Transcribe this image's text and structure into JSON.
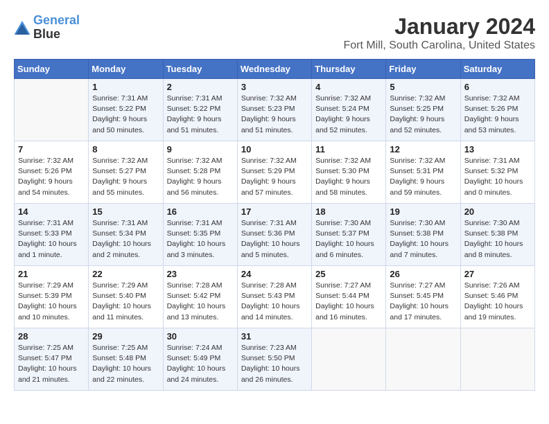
{
  "logo": {
    "line1": "General",
    "line2": "Blue"
  },
  "title": "January 2024",
  "subtitle": "Fort Mill, South Carolina, United States",
  "days_of_week": [
    "Sunday",
    "Monday",
    "Tuesday",
    "Wednesday",
    "Thursday",
    "Friday",
    "Saturday"
  ],
  "weeks": [
    [
      {
        "day": "",
        "info": ""
      },
      {
        "day": "1",
        "info": "Sunrise: 7:31 AM\nSunset: 5:22 PM\nDaylight: 9 hours\nand 50 minutes."
      },
      {
        "day": "2",
        "info": "Sunrise: 7:31 AM\nSunset: 5:22 PM\nDaylight: 9 hours\nand 51 minutes."
      },
      {
        "day": "3",
        "info": "Sunrise: 7:32 AM\nSunset: 5:23 PM\nDaylight: 9 hours\nand 51 minutes."
      },
      {
        "day": "4",
        "info": "Sunrise: 7:32 AM\nSunset: 5:24 PM\nDaylight: 9 hours\nand 52 minutes."
      },
      {
        "day": "5",
        "info": "Sunrise: 7:32 AM\nSunset: 5:25 PM\nDaylight: 9 hours\nand 52 minutes."
      },
      {
        "day": "6",
        "info": "Sunrise: 7:32 AM\nSunset: 5:26 PM\nDaylight: 9 hours\nand 53 minutes."
      }
    ],
    [
      {
        "day": "7",
        "info": "Sunrise: 7:32 AM\nSunset: 5:26 PM\nDaylight: 9 hours\nand 54 minutes."
      },
      {
        "day": "8",
        "info": "Sunrise: 7:32 AM\nSunset: 5:27 PM\nDaylight: 9 hours\nand 55 minutes."
      },
      {
        "day": "9",
        "info": "Sunrise: 7:32 AM\nSunset: 5:28 PM\nDaylight: 9 hours\nand 56 minutes."
      },
      {
        "day": "10",
        "info": "Sunrise: 7:32 AM\nSunset: 5:29 PM\nDaylight: 9 hours\nand 57 minutes."
      },
      {
        "day": "11",
        "info": "Sunrise: 7:32 AM\nSunset: 5:30 PM\nDaylight: 9 hours\nand 58 minutes."
      },
      {
        "day": "12",
        "info": "Sunrise: 7:32 AM\nSunset: 5:31 PM\nDaylight: 9 hours\nand 59 minutes."
      },
      {
        "day": "13",
        "info": "Sunrise: 7:31 AM\nSunset: 5:32 PM\nDaylight: 10 hours\nand 0 minutes."
      }
    ],
    [
      {
        "day": "14",
        "info": "Sunrise: 7:31 AM\nSunset: 5:33 PM\nDaylight: 10 hours\nand 1 minute."
      },
      {
        "day": "15",
        "info": "Sunrise: 7:31 AM\nSunset: 5:34 PM\nDaylight: 10 hours\nand 2 minutes."
      },
      {
        "day": "16",
        "info": "Sunrise: 7:31 AM\nSunset: 5:35 PM\nDaylight: 10 hours\nand 3 minutes."
      },
      {
        "day": "17",
        "info": "Sunrise: 7:31 AM\nSunset: 5:36 PM\nDaylight: 10 hours\nand 5 minutes."
      },
      {
        "day": "18",
        "info": "Sunrise: 7:30 AM\nSunset: 5:37 PM\nDaylight: 10 hours\nand 6 minutes."
      },
      {
        "day": "19",
        "info": "Sunrise: 7:30 AM\nSunset: 5:38 PM\nDaylight: 10 hours\nand 7 minutes."
      },
      {
        "day": "20",
        "info": "Sunrise: 7:30 AM\nSunset: 5:38 PM\nDaylight: 10 hours\nand 8 minutes."
      }
    ],
    [
      {
        "day": "21",
        "info": "Sunrise: 7:29 AM\nSunset: 5:39 PM\nDaylight: 10 hours\nand 10 minutes."
      },
      {
        "day": "22",
        "info": "Sunrise: 7:29 AM\nSunset: 5:40 PM\nDaylight: 10 hours\nand 11 minutes."
      },
      {
        "day": "23",
        "info": "Sunrise: 7:28 AM\nSunset: 5:42 PM\nDaylight: 10 hours\nand 13 minutes."
      },
      {
        "day": "24",
        "info": "Sunrise: 7:28 AM\nSunset: 5:43 PM\nDaylight: 10 hours\nand 14 minutes."
      },
      {
        "day": "25",
        "info": "Sunrise: 7:27 AM\nSunset: 5:44 PM\nDaylight: 10 hours\nand 16 minutes."
      },
      {
        "day": "26",
        "info": "Sunrise: 7:27 AM\nSunset: 5:45 PM\nDaylight: 10 hours\nand 17 minutes."
      },
      {
        "day": "27",
        "info": "Sunrise: 7:26 AM\nSunset: 5:46 PM\nDaylight: 10 hours\nand 19 minutes."
      }
    ],
    [
      {
        "day": "28",
        "info": "Sunrise: 7:25 AM\nSunset: 5:47 PM\nDaylight: 10 hours\nand 21 minutes."
      },
      {
        "day": "29",
        "info": "Sunrise: 7:25 AM\nSunset: 5:48 PM\nDaylight: 10 hours\nand 22 minutes."
      },
      {
        "day": "30",
        "info": "Sunrise: 7:24 AM\nSunset: 5:49 PM\nDaylight: 10 hours\nand 24 minutes."
      },
      {
        "day": "31",
        "info": "Sunrise: 7:23 AM\nSunset: 5:50 PM\nDaylight: 10 hours\nand 26 minutes."
      },
      {
        "day": "",
        "info": ""
      },
      {
        "day": "",
        "info": ""
      },
      {
        "day": "",
        "info": ""
      }
    ]
  ]
}
